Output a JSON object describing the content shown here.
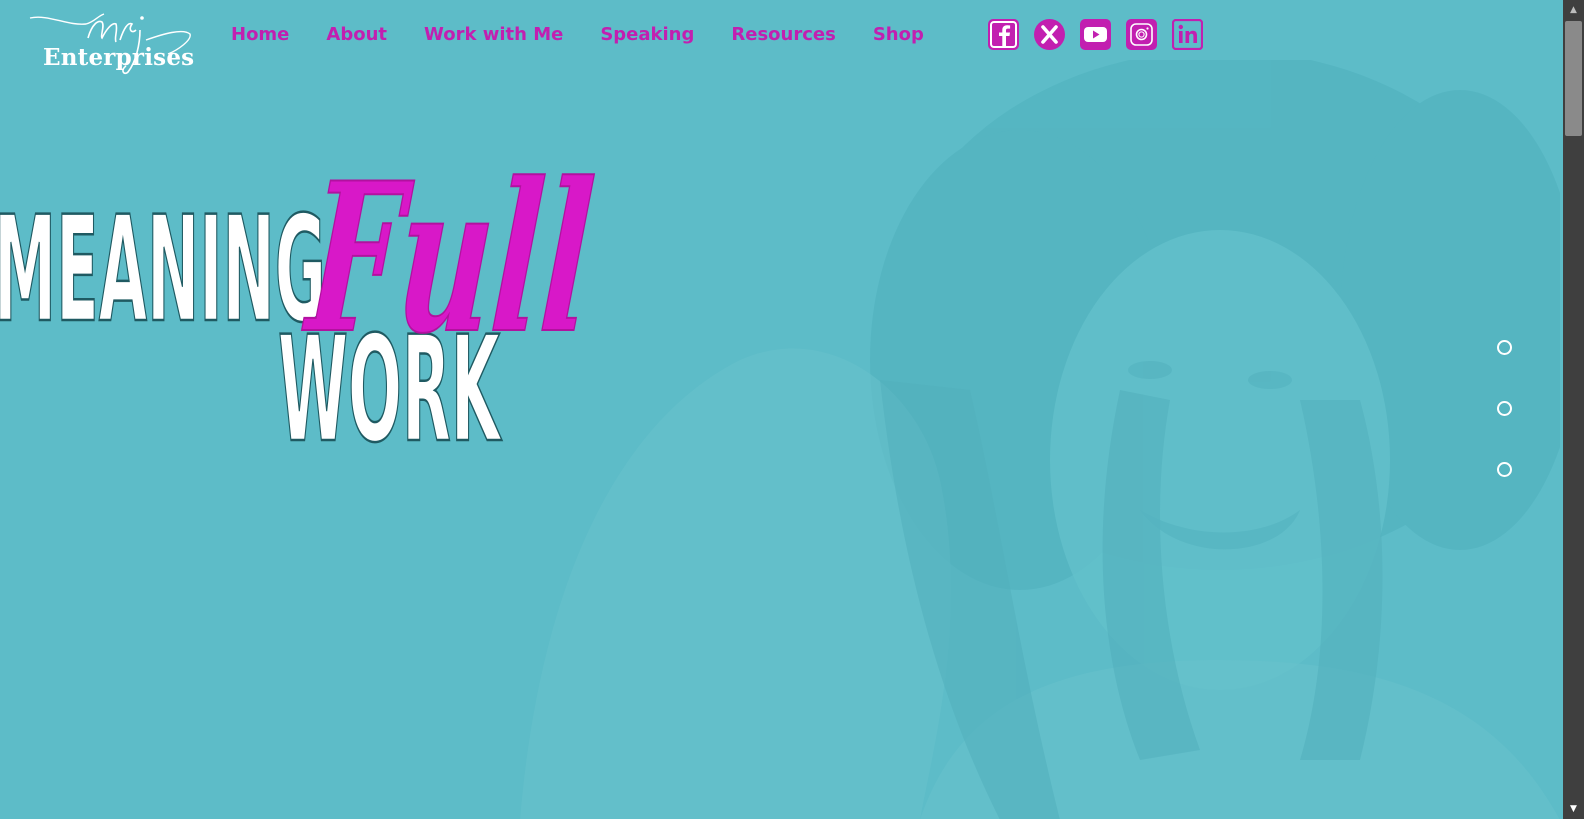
{
  "brand": {
    "script_text": "nrj",
    "name": "Enterprises"
  },
  "nav": {
    "items": [
      {
        "label": "Home"
      },
      {
        "label": "About"
      },
      {
        "label": "Work with Me"
      },
      {
        "label": "Speaking"
      },
      {
        "label": "Resources"
      },
      {
        "label": "Shop"
      }
    ]
  },
  "social": [
    {
      "icon": "facebook-icon"
    },
    {
      "icon": "x-icon"
    },
    {
      "icon": "youtube-icon"
    },
    {
      "icon": "instagram-icon"
    },
    {
      "icon": "linkedin-icon"
    }
  ],
  "hero": {
    "line1": "MEANING",
    "script": "Full",
    "line2": "WORK"
  },
  "slider": {
    "dot_count": 3
  },
  "colors": {
    "background": "#5dbcc8",
    "accent": "#c21fb0",
    "hero_text": "#ffffff",
    "hero_outline": "#1f5a62",
    "scrollbar": "#3f3f3f"
  }
}
